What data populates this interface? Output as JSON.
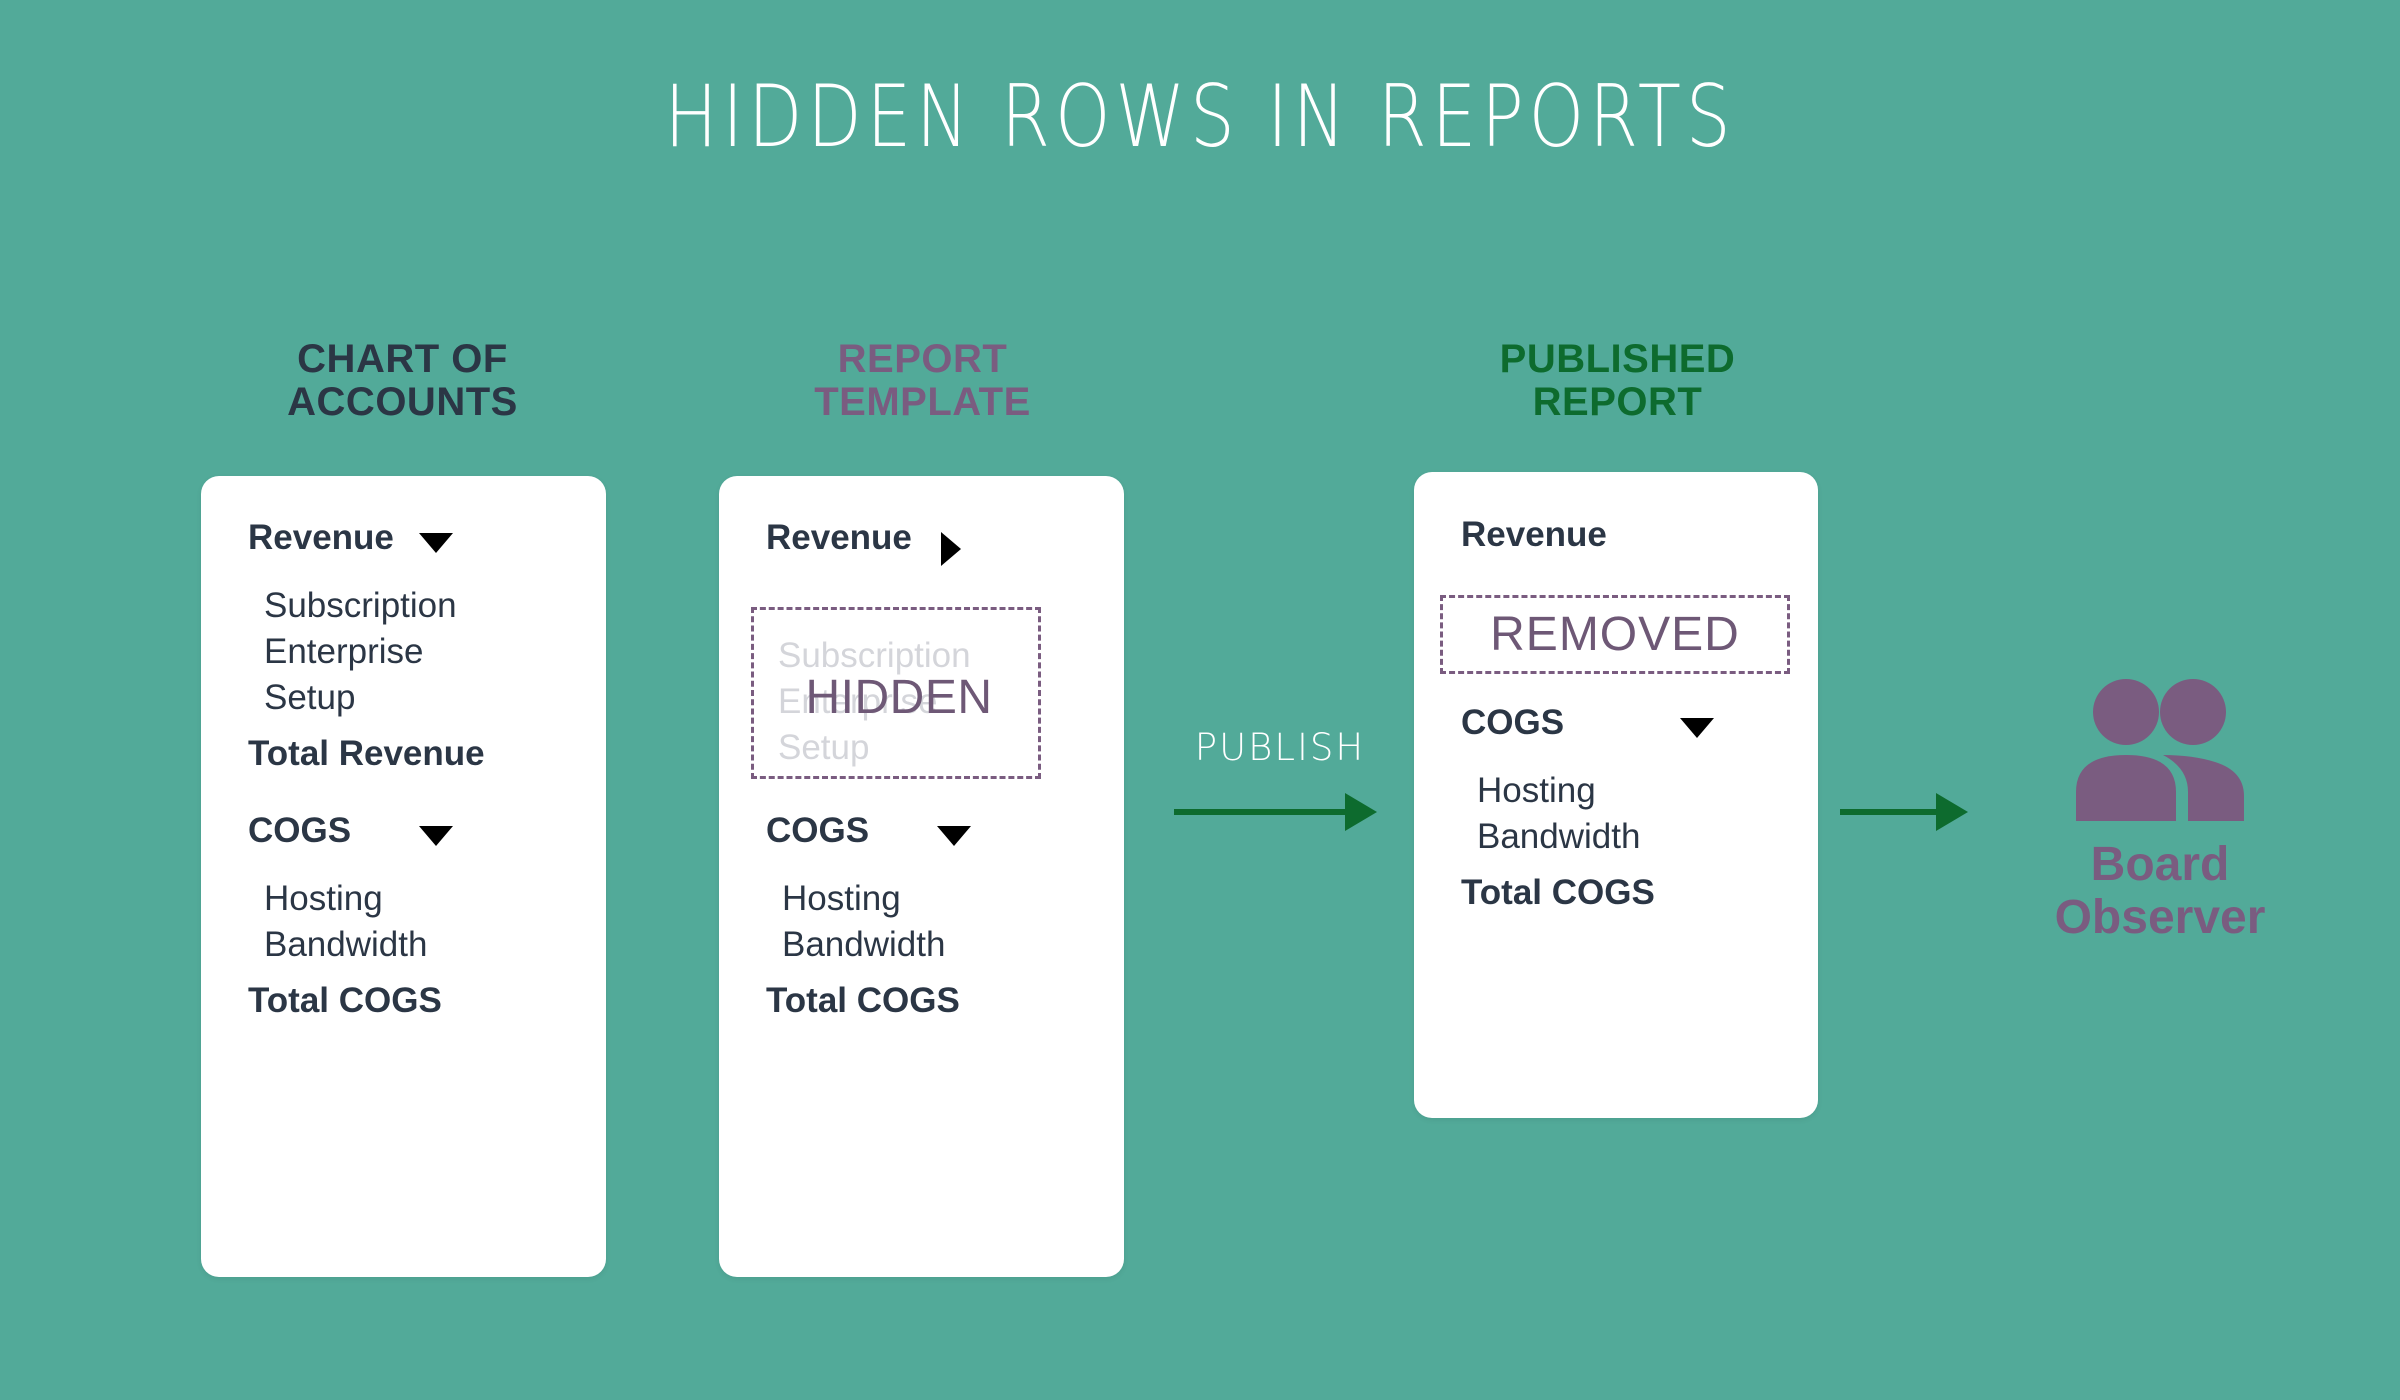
{
  "title": "HIDDEN ROWS IN REPORTS",
  "background_color": "#52aa99",
  "columns": [
    {
      "header": "CHART OF\nACCOUNTS",
      "header_color": "#2b3645",
      "card": {
        "rows": [
          {
            "label": "Revenue",
            "type": "group",
            "toggle": "chevron-down-icon"
          },
          {
            "label": "Subscription",
            "type": "item"
          },
          {
            "label": "Enterprise",
            "type": "item"
          },
          {
            "label": "Setup",
            "type": "item"
          },
          {
            "label": "Total Revenue",
            "type": "total"
          },
          {
            "label": "COGS",
            "type": "group",
            "toggle": "chevron-down-icon"
          },
          {
            "label": "Hosting",
            "type": "item"
          },
          {
            "label": "Bandwidth",
            "type": "item"
          },
          {
            "label": "Total COGS",
            "type": "total"
          }
        ]
      }
    },
    {
      "header": "REPORT\nTEMPLATE",
      "header_color": "#7a5c80",
      "card": {
        "rows": [
          {
            "label": "Revenue",
            "type": "group",
            "toggle": "chevron-right-icon"
          },
          {
            "label": "COGS",
            "type": "group",
            "toggle": "chevron-down-icon"
          },
          {
            "label": "Hosting",
            "type": "item"
          },
          {
            "label": "Bandwidth",
            "type": "item"
          },
          {
            "label": "Total COGS",
            "type": "total"
          }
        ],
        "hidden_block": {
          "stamp": "HIDDEN",
          "stamp_color": "#6e5876",
          "border_color": "#7a5c80",
          "ghost_rows": [
            "Subscription",
            "Enterprise",
            "Setup"
          ],
          "ghost_color": "#d4d5da"
        }
      }
    },
    {
      "header": "PUBLISHED\nREPORT",
      "header_color": "#0d6b2e",
      "card": {
        "rows": [
          {
            "label": "Revenue",
            "type": "group"
          },
          {
            "label": "COGS",
            "type": "group",
            "toggle": "chevron-down-icon"
          },
          {
            "label": "Hosting",
            "type": "item"
          },
          {
            "label": "Bandwidth",
            "type": "item"
          },
          {
            "label": "Total COGS",
            "type": "total"
          }
        ],
        "removed_block": {
          "label": "REMOVED",
          "label_color": "#6e5876",
          "border_color": "#7a5c80"
        }
      }
    }
  ],
  "flow": {
    "publish_label": "PUBLISH",
    "arrow_color": "#0d6b2e"
  },
  "audience": {
    "icon": "people-icon",
    "label": "Board\nObserver",
    "color": "#7a5c80"
  }
}
